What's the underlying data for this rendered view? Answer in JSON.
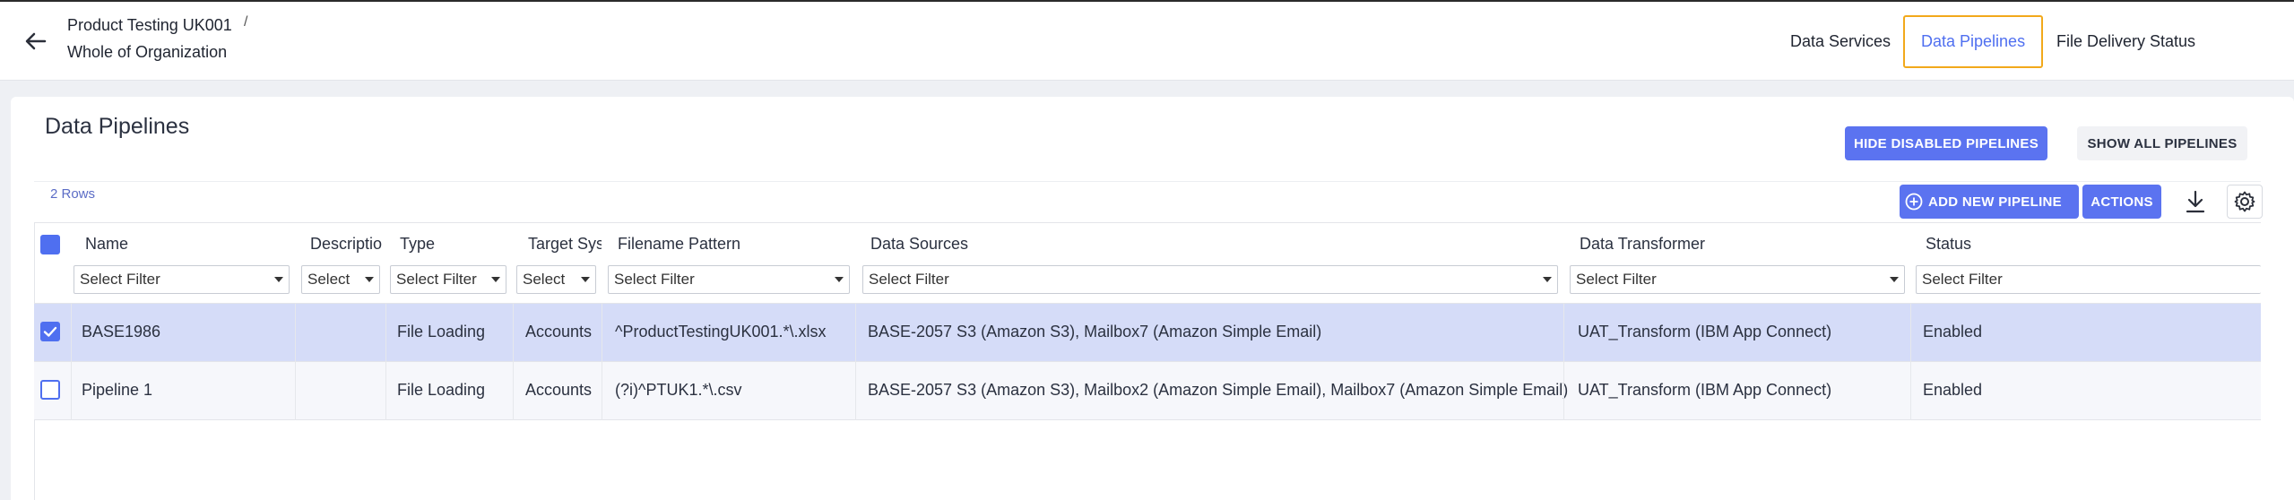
{
  "header": {
    "breadcrumb_parent": "Product Testing UK001",
    "breadcrumb_separator": "/",
    "breadcrumb_current": "Whole of Organization",
    "nav_tabs": [
      {
        "label": "Data Services"
      },
      {
        "label": "Data Pipelines"
      },
      {
        "label": "File Delivery Status"
      }
    ],
    "active_tab": "Data Pipelines"
  },
  "page": {
    "title": "Data Pipelines",
    "hide_disabled_label": "HIDE DISABLED PIPELINES",
    "show_all_label": "SHOW ALL PIPELINES",
    "row_count": "2 Rows",
    "add_new_label": "ADD NEW PIPELINE",
    "actions_label": "ACTIONS"
  },
  "table": {
    "columns": [
      {
        "label": "Name",
        "filter": "Select Filter"
      },
      {
        "label": "Descriptio",
        "filter": "Select"
      },
      {
        "label": "Type",
        "filter": "Select Filter"
      },
      {
        "label": "Target Sys",
        "filter": "Select"
      },
      {
        "label": "Filename Pattern",
        "filter": "Select Filter"
      },
      {
        "label": "Data Sources",
        "filter": "Select Filter"
      },
      {
        "label": "Data Transformer",
        "filter": "Select Filter"
      },
      {
        "label": "Status",
        "filter": "Select Filter"
      }
    ],
    "rows": [
      {
        "checked": true,
        "name": "BASE1986",
        "description": "",
        "type": "File Loading",
        "target_system": "Accounts",
        "filename_pattern": "^ProductTestingUK001.*\\.xlsx",
        "data_sources": "BASE-2057 S3 (Amazon S3), Mailbox7 (Amazon Simple Email)",
        "data_transformer": "UAT_Transform (IBM App Connect)",
        "status": "Enabled"
      },
      {
        "checked": false,
        "name": "Pipeline 1",
        "description": "",
        "type": "File Loading",
        "target_system": "Accounts",
        "filename_pattern": "(?i)^PTUK1.*\\.csv",
        "data_sources": "BASE-2057 S3 (Amazon S3), Mailbox2 (Amazon Simple Email), Mailbox7 (Amazon Simple Email)",
        "data_transformer": "UAT_Transform (IBM App Connect)",
        "status": "Enabled"
      }
    ]
  },
  "icons": {
    "back": "arrow-left-icon",
    "add": "plus-circle-icon",
    "download": "download-icon",
    "settings": "gear-icon"
  },
  "colors": {
    "accent": "#5b73f0",
    "active_tab_border": "#f2a91b",
    "selected_row": "#d5dcf8"
  }
}
